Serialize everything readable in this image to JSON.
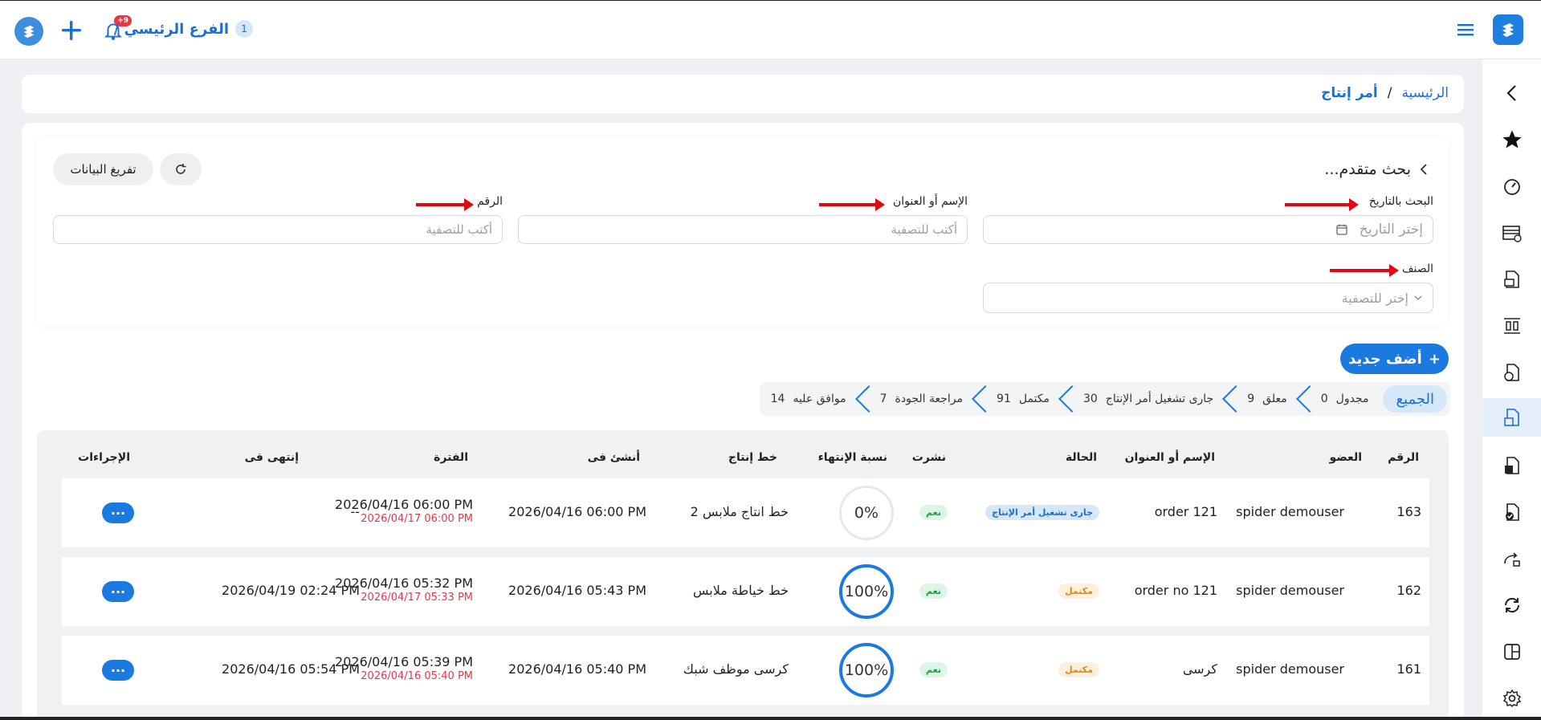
{
  "topbar": {
    "branch_label": "الفرع الرئيسي /",
    "branch_number": "1",
    "notif_badge": "+9"
  },
  "breadcrumb": {
    "home": "الرئيسية",
    "sep": "/",
    "current": "أمر إنتاج"
  },
  "search": {
    "title": "بحث متقدم...",
    "clear_button": "تفريغ البيانات",
    "date_label": "البحث بالتاريخ",
    "date_placeholder": "إختر التاريخ",
    "name_label": "الإسم أو العنوان",
    "name_placeholder": "أكتب للتصفية",
    "number_label": "الرقم",
    "number_placeholder": "أكتب للتصفية",
    "class_label": "الصنف",
    "class_placeholder": "إختر للتصفية"
  },
  "add_button": "أضف جديد",
  "tabs": [
    {
      "label": "الجميع",
      "count": ""
    },
    {
      "label": "مجدول",
      "count": "0"
    },
    {
      "label": "معلق",
      "count": "9"
    },
    {
      "label": "جارى تشغيل أمر الإنتاج",
      "count": "30"
    },
    {
      "label": "مكتمل",
      "count": "91"
    },
    {
      "label": "مراجعة الجودة",
      "count": "7"
    },
    {
      "label": "موافق عليه",
      "count": "14"
    }
  ],
  "table": {
    "headers": {
      "number": "الرقم",
      "member": "العضو",
      "name": "الإسم أو العنوان",
      "status": "الحالة",
      "published": "نشرت",
      "completion": "نسبة الإنتهاء",
      "line": "خط إنتاج",
      "created": "أنشئ فى",
      "period": "الفترة",
      "ended": "إنتهى فى",
      "actions": "الإجراءات"
    },
    "rows": [
      {
        "number": "163",
        "member": "spider demouser",
        "name": "order 121",
        "status": "جارى تشغيل أمر الإنتاج",
        "published": "نعم",
        "completion": "0%",
        "line": "خط انتاج ملابس 2",
        "created": "2026/04/16 06:00 PM",
        "period_start": "2026/04/16 06:00 PM",
        "period_end": "2026/04/17 06:00 PM",
        "ended": "--"
      },
      {
        "number": "162",
        "member": "spider demouser",
        "name": "order no 121",
        "status": "مكتمل",
        "published": "نعم",
        "completion": "100%",
        "line": "خط خياطة ملابس",
        "created": "2026/04/16 05:43 PM",
        "period_start": "2026/04/16 05:32 PM",
        "period_end": "2026/04/17 05:33 PM",
        "ended": "2026/04/19 02:24 PM"
      },
      {
        "number": "161",
        "member": "spider demouser",
        "name": "كرسى",
        "status": "مكتمل",
        "published": "نعم",
        "completion": "100%",
        "line": "كرسى موظف شبك",
        "created": "2026/04/16 05:40 PM",
        "period_start": "2026/04/16 05:39 PM",
        "period_end": "2026/04/16 05:40 PM",
        "ended": "2026/04/16 05:54 PM"
      }
    ]
  },
  "colors": {
    "accent": "#1a7ae0",
    "danger": "#e3384a",
    "success": "#17a24a",
    "warning": "#e6850e"
  }
}
